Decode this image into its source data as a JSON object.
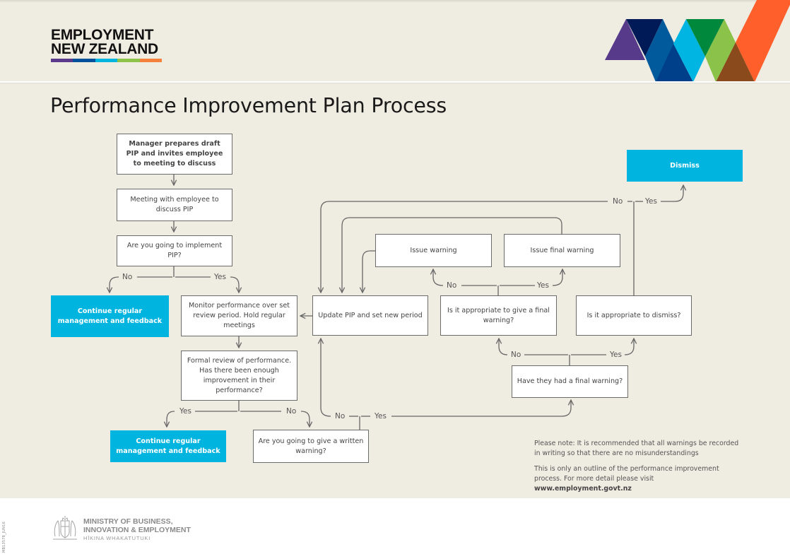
{
  "header": {
    "logo_line1": "EMPLOYMENT",
    "logo_line2": "NEW ZEALAND",
    "logo_bar_colors": [
      "#5b3a8c",
      "#00539b",
      "#00b4e0",
      "#8dc34a",
      "#f5823c"
    ],
    "brandmark_colors": {
      "purple": "#573b8a",
      "navy": "#001a57",
      "blue": "#005a9c",
      "darkblue": "#003f8a",
      "cyan": "#00b5e2",
      "green": "#00893d",
      "lime": "#8bc34a",
      "brown": "#8b4a1c",
      "orange": "#ff5f2b"
    }
  },
  "page": {
    "title": "Performance Improvement Plan Process"
  },
  "colors": {
    "background": "#efece2",
    "terminal_box": "#00b4e0",
    "box_border": "#6b6b6b",
    "connector": "#666666"
  },
  "flow": {
    "nodes": {
      "prepare": "Manager prepares draft PIP and invites employee to meeting to discuss",
      "meeting": "Meeting with employee to discuss PIP",
      "implement_q": "Are you going to implement PIP?",
      "continue1": "Continue regular management and feedback",
      "monitor": "Monitor performance over set review period. Hold regular meetings",
      "review": "Formal review of performance. Has there been enough improvement in their performance?",
      "continue2": "Continue regular management and feedback",
      "written_q": "Are you going to give a written warning?",
      "update": "Update PIP and set new period",
      "issue_warning": "Issue warning",
      "issue_final": "Issue final warning",
      "final_q": "Is it appropriate to give a final warning?",
      "dismiss_q": "Is it appropriate to dismiss?",
      "had_final_q": "Have they had a final warning?",
      "dismiss": "Dismiss"
    },
    "labels": {
      "no": "No",
      "yes": "Yes"
    }
  },
  "notes": {
    "note1": "Please note: It is recommended that all warnings be recorded in writing so that there are no misunderstandings",
    "note2_text": "This is only an outline of the performance improvement process. For more detail please visit ",
    "note2_link": "www.employment.govt.nz"
  },
  "footer": {
    "code": "MB13578_JUN16",
    "ministry_line1": "MINISTRY OF BUSINESS,",
    "ministry_line2": "INNOVATION & EMPLOYMENT",
    "ministry_line3": "HĪKINA WHAKATUTUKI"
  }
}
